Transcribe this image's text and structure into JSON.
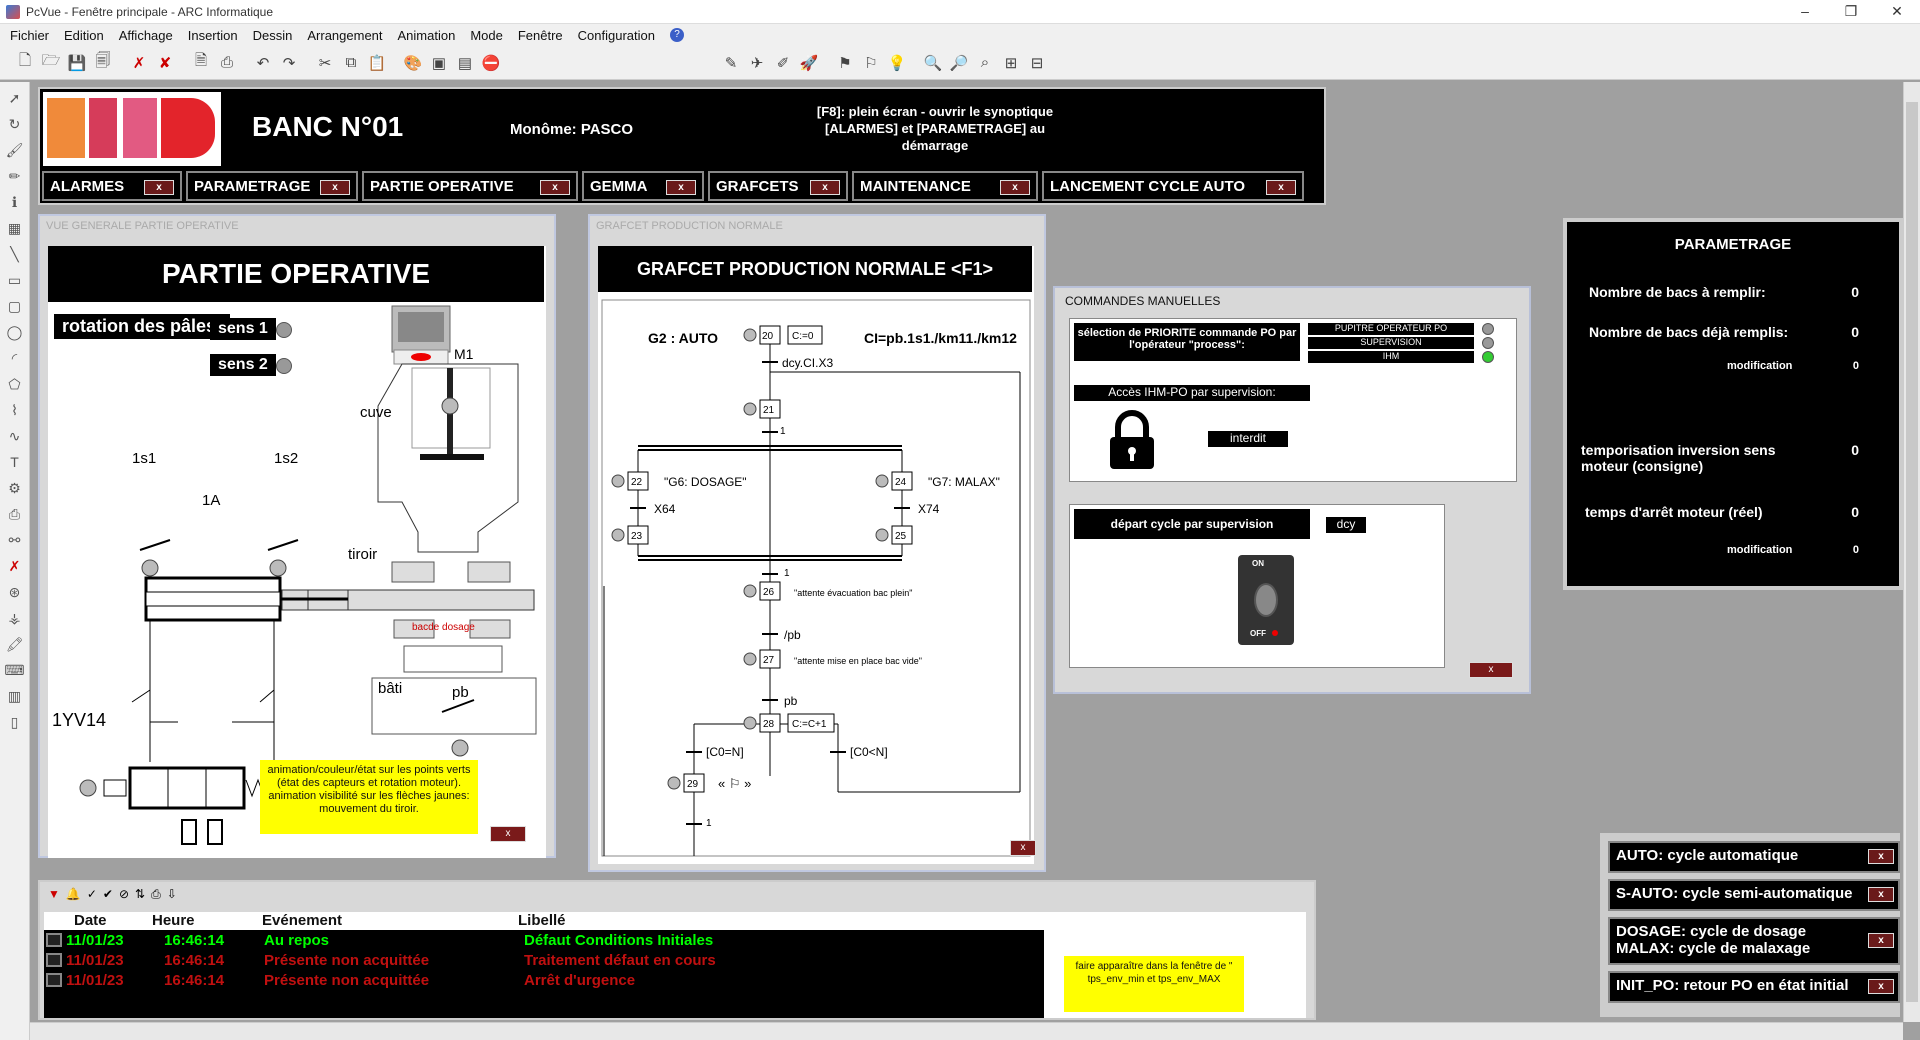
{
  "window": {
    "title": "PcVue - Fenêtre principale - ARC Informatique",
    "minimize": "–",
    "restore": "❐",
    "close": "✕"
  },
  "menu": [
    "Fichier",
    "Edition",
    "Affichage",
    "Insertion",
    "Dessin",
    "Arrangement",
    "Animation",
    "Mode",
    "Fenêtre",
    "Configuration"
  ],
  "header": {
    "banc": "BANC N°01",
    "monome": "Monôme: PASCO",
    "f8_line1": "[F8]: plein écran - ouvrir le synoptique",
    "f8_line2": "[ALARMES] et [PARAMETRAGE] au",
    "f8_line3": "démarrage",
    "nav": [
      "ALARMES",
      "PARAMETRAGE",
      "PARTIE OPERATIVE",
      "GEMMA",
      "GRAFCETS",
      "MAINTENANCE",
      "LANCEMENT CYCLE AUTO"
    ],
    "x": "x"
  },
  "po": {
    "window_title": "VUE GENERALE PARTIE OPERATIVE",
    "title": "PARTIE OPERATIVE",
    "rotation": "rotation des pâles:",
    "sens1": "sens 1",
    "sens2": "sens 2",
    "m1": "M1",
    "cuve": "cuve",
    "c1s1": "1s1",
    "c1s2": "1s2",
    "c1a": "1A",
    "tiroir": "tiroir",
    "bac": "bacde dosage",
    "bati": "bâti",
    "pb": "pb",
    "yv": "1YV14",
    "note": "animation/couleur/état sur les points verts (état des capteurs et rotation moteur). animation visibilité sur les flèches jaunes: mouvement du tiroir."
  },
  "grafcet": {
    "window_title": "GRAFCET PRODUCTION NORMALE",
    "title": "GRAFCET PRODUCTION NORMALE <F1>",
    "g2": "G2 : AUTO",
    "ci": "CI=pb.1s1./km11./km12",
    "s20": "20",
    "a20": "C:=0",
    "t1": "dcy.CI.X3",
    "s21": "21",
    "t21": "1",
    "s22": "22",
    "a22": "\"G6: DOSAGE\"",
    "s24": "24",
    "a24": "\"G7: MALAX\"",
    "t22": "X64",
    "t24": "X74",
    "s23": "23",
    "s25": "25",
    "tjoin": "1",
    "s26": "26",
    "a26": "\"attente évacuation bac plein\"",
    "t26": "/pb",
    "s27": "27",
    "a27": "\"attente mise en place bac vide\"",
    "t27": "pb",
    "s28": "28",
    "a28": "C:=C+1",
    "tcn": "[C0=N]",
    "tcinf": "[C0<N]",
    "s29": "29",
    "a29": "« ⚐ »",
    "t29": "1"
  },
  "cm": {
    "title": "COMMANDES MANUELLES",
    "prio": "sélection de PRIORITE commande PO par l'opérateur \"process\":",
    "opt1": "PUPITRE OPERATEUR PO",
    "opt2": "SUPERVISION",
    "opt3": "IHM",
    "acces": "Accès IHM-PO par supervision:",
    "interdit": "interdit",
    "depart": "départ cycle par supervision",
    "dcy": "dcy",
    "on": "ON",
    "off": "OFF"
  },
  "param": {
    "title": "PARAMETRAGE",
    "l1": "Nombre de bacs à remplir:",
    "v1": "0",
    "l2": "Nombre de bacs déjà remplis:",
    "v2": "0",
    "mod1": "modification",
    "v3": "0",
    "l4": "temporisation inversion sens moteur (consigne)",
    "v4": "0",
    "l5": "temps d'arrêt moteur (réel)",
    "v5": "0",
    "mod2": "modification",
    "v6": "0"
  },
  "modes": [
    "AUTO: cycle automatique",
    "S-AUTO: cycle semi-automatique",
    "DOSAGE: cycle de dosage",
    "MALAX: cycle de malaxage",
    "INIT_PO: retour PO en état initial"
  ],
  "alarm": {
    "cols": [
      "Date",
      "Heure",
      "Evénement",
      "Libellé"
    ],
    "rows": [
      {
        "date": "11/01/23",
        "time": "16:46:14",
        "event": "Au repos",
        "label": "Défaut Conditions Initiales",
        "color": "#00ff00"
      },
      {
        "date": "11/01/23",
        "time": "16:46:14",
        "event": "Présente non acquittée",
        "label": "Traitement défaut en cours",
        "color": "#c01010"
      },
      {
        "date": "11/01/23",
        "time": "16:46:14",
        "event": "Présente non acquittée",
        "label": "Arrêt d'urgence",
        "color": "#c01010"
      }
    ],
    "note": "faire apparaître dans la fenêtre de \" tps_env_min et tps_env_MAX"
  }
}
